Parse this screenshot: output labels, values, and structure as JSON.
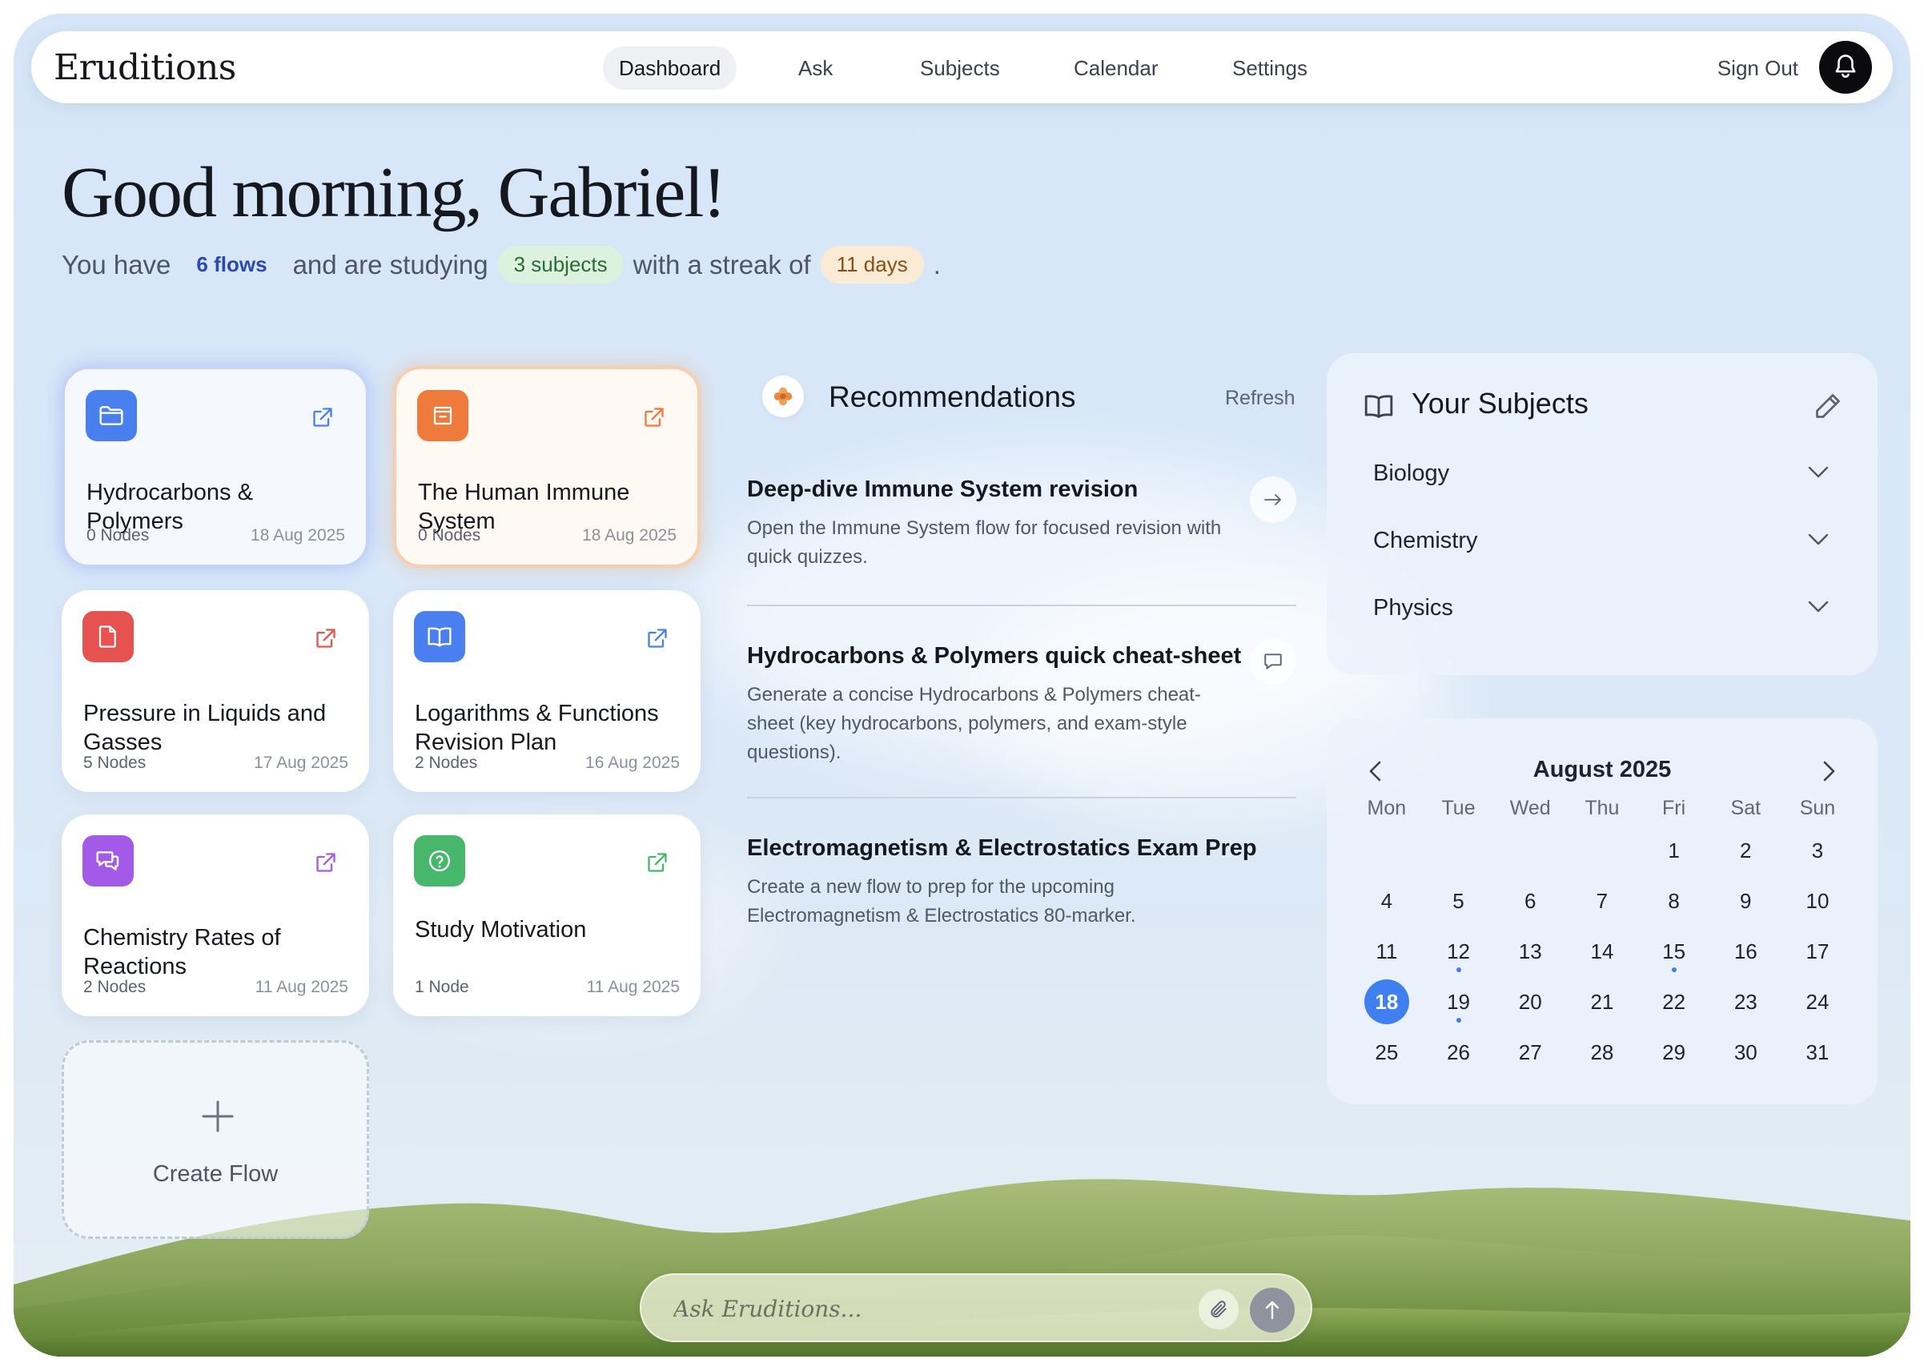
{
  "nav": {
    "brand": "Eruditions",
    "links": [
      {
        "label": "Dashboard",
        "active": true
      },
      {
        "label": "Ask"
      },
      {
        "label": "Subjects"
      },
      {
        "label": "Calendar"
      },
      {
        "label": "Settings"
      }
    ],
    "sign_out": "Sign Out",
    "bell_icon": "bell-icon"
  },
  "greeting": {
    "title": "Good morning, Gabriel!",
    "prefix": "You have",
    "flows": "6 flows",
    "mid1": "and are studying",
    "subjects": "3 subjects",
    "mid2": "with a streak of",
    "days": "11 days",
    "suffix": "."
  },
  "colors": {
    "accent": "#3f7ff0",
    "blue": "#4a7ff0",
    "orange": "#ee7a3c",
    "red": "#e5524f",
    "purple": "#a35ae9",
    "green": "#47b86b"
  },
  "flows": [
    {
      "title": "Hydrocarbons & Polymers",
      "nodes": "0 Nodes",
      "date": "18 Aug 2025",
      "icon": "folder-icon",
      "color": "#4a7ff0"
    },
    {
      "title": "The Human Immune System",
      "nodes": "0 Nodes",
      "date": "18 Aug 2025",
      "icon": "archive-box-icon",
      "color": "#ee7a3c"
    },
    {
      "title": "Pressure in Liquids and Gasses",
      "nodes": "5 Nodes",
      "date": "17 Aug 2025",
      "icon": "document-icon",
      "color": "#e5524f"
    },
    {
      "title": "Logarithms & Functions Revision Plan",
      "nodes": "2 Nodes",
      "date": "16 Aug 2025",
      "icon": "book-icon",
      "color": "#4a7ff0"
    },
    {
      "title": "Chemistry Rates of Reactions",
      "nodes": "2 Nodes",
      "date": "11 Aug 2025",
      "icon": "chat-bubbles-icon",
      "color": "#a35ae9"
    },
    {
      "title": "Study Motivation",
      "nodes": "1 Node",
      "date": "11 Aug 2025",
      "icon": "question-circle-icon",
      "color": "#47b86b"
    }
  ],
  "create_flow": {
    "label": "Create Flow"
  },
  "recommendations": {
    "title": "Recommendations",
    "refresh": "Refresh",
    "items": [
      {
        "title": "Deep-dive Immune System revision",
        "desc": "Open the Immune System flow for focused revision with quick quizzes.",
        "action_icon": "arrow-right-icon"
      },
      {
        "title": "Hydrocarbons & Polymers quick cheat-sheet",
        "desc": "Generate a concise Hydrocarbons & Polymers cheat-sheet (key hydrocarbons, polymers, and exam-style questions).",
        "action_icon": "chat-icon"
      },
      {
        "title": "Electromagnetism & Electrostatics Exam Prep",
        "desc": "Create a new flow to prep for the upcoming Electromagnetism & Electrostatics 80-marker."
      }
    ]
  },
  "subjects": {
    "title": "Your Subjects",
    "items": [
      "Biology",
      "Chemistry",
      "Physics"
    ]
  },
  "calendar": {
    "month": "August 2025",
    "weekdays": [
      "Mon",
      "Tue",
      "Wed",
      "Thu",
      "Fri",
      "Sat",
      "Sun"
    ],
    "weeks": [
      [
        "",
        "",
        "",
        "",
        "1",
        "2",
        "3"
      ],
      [
        "4",
        "5",
        "6",
        "7",
        "8",
        "9",
        "10"
      ],
      [
        "11",
        "12",
        "13",
        "14",
        "15",
        "16",
        "17"
      ],
      [
        "18",
        "19",
        "20",
        "21",
        "22",
        "23",
        "24"
      ],
      [
        "25",
        "26",
        "27",
        "28",
        "29",
        "30",
        "31"
      ]
    ],
    "today": "18",
    "dot_days": [
      "12",
      "15",
      "19"
    ]
  },
  "ask": {
    "placeholder": "Ask Eruditions..."
  }
}
